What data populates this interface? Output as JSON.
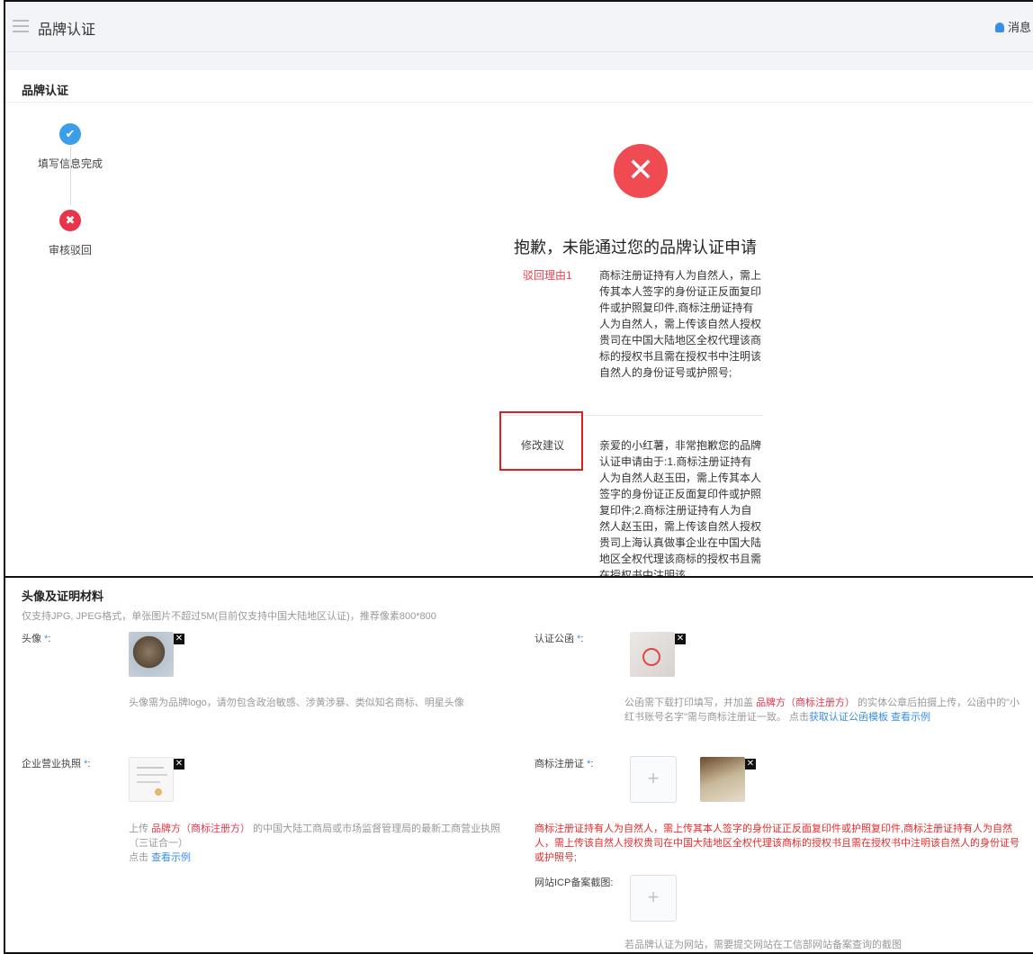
{
  "header": {
    "title": "品牌认证",
    "message": "消息"
  },
  "section_title": "品牌认证",
  "steps": [
    {
      "label": "填写信息完成",
      "icon": "✔"
    },
    {
      "label": "审核驳回",
      "icon": "✖"
    }
  ],
  "result": {
    "icon": "✕",
    "title": "抱歉，未能通过您的品牌认证申请",
    "reason_label": "驳回理由1",
    "reason_text": "商标注册证持有人为自然人，需上传其本人签字的身份证正反面复印件或护照复印件,商标注册证持有人为自然人，需上传该自然人授权贵司在中国大陆地区全权代理该商标的授权书且需在授权书中注明该自然人的身份证号或护照号;",
    "suggest_label": "修改建议",
    "suggest_text": "亲爱的小红薯，非常抱歉您的品牌认证申请由于:1.商标注册证持有人为自然人赵玉田，需上传其本人签字的身份证正反面复印件或护照复印件;2.商标注册证持有人为自然人赵玉田，需上传该自然人授权贵司上海认真做事企业在中国大陆地区全权代理该商标的授权书且需在授权书中注明该"
  },
  "materials": {
    "title": "头像及证明材料",
    "subtitle": "仅支持JPG, JPEG格式，单张图片不超过5M(目前仅支持中国大陆地区认证)，推荐像素800*800",
    "required_mark": "*",
    "avatar": {
      "label": "头像",
      "hint": "头像需为品牌logo，请勿包含政治敏感、涉黄涉暴、类似知名商标、明星头像"
    },
    "letter": {
      "label": "认证公函",
      "hint_1": "公函需下载打印填写，并加盖",
      "hint_red": "品牌方（商标注册方）",
      "hint_2": "的实体公章后拍摄上传，公函中的\"小红书账号名字\"需与商标注册证一致。 点击",
      "link_template": "获取认证公函模板",
      "link_example": "查看示例"
    },
    "license": {
      "label": "企业营业执照",
      "hint_1": "上传",
      "hint_red": "品牌方（商标注册方）",
      "hint_2": " 的中国大陆工商局或市场监督管理局的最新工商营业执照（三证合一）",
      "hint_click": "点击",
      "link_example": "查看示例"
    },
    "trademark": {
      "label": "商标注册证",
      "error": "商标注册证持有人为自然人，需上传其本人签字的身份证正反面复印件或护照复印件,商标注册证持有人为自然人，需上传该自然人授权贵司在中国大陆地区全权代理该商标的授权书且需在授权书中注明该自然人的身份证号或护照号;"
    },
    "icp": {
      "label": "网站ICP备案截图",
      "hint": "若品牌认证为网站，需要提交网站在工信部网站备案查询的截图"
    },
    "upload_plus": "+",
    "remove_icon": "✕"
  },
  "colors": {
    "accent": "#3a8ee6",
    "danger": "#e8354b",
    "topbar": "#f2f4f7"
  }
}
